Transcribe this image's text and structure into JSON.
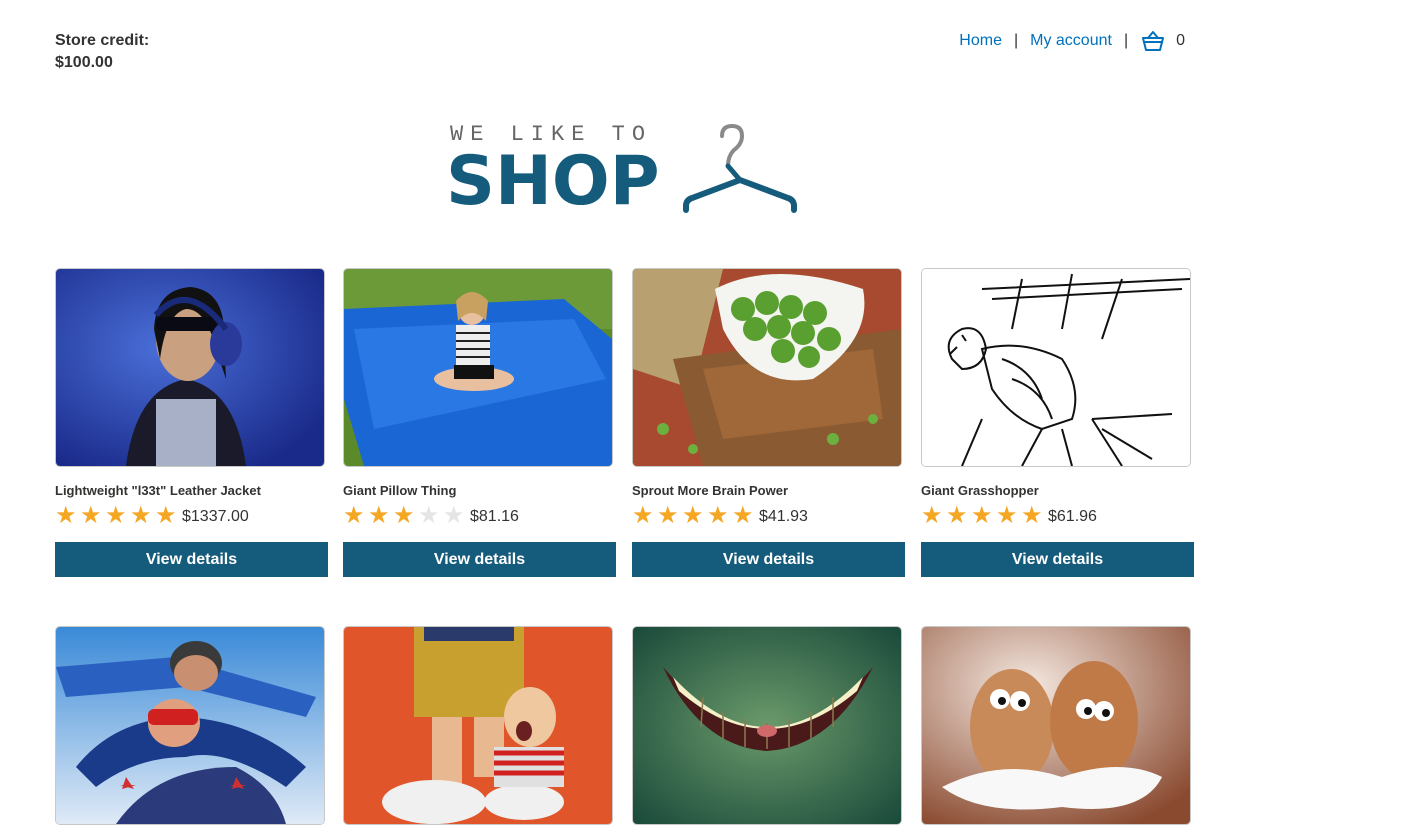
{
  "header": {
    "credit_label": "Store credit:",
    "credit_value": "$100.00",
    "nav_home": "Home",
    "nav_account": "My account",
    "separator": "|",
    "cart_icon": "cart-icon",
    "cart_count": "0"
  },
  "logo": {
    "tagline": "WE LIKE TO",
    "word": "SHOP",
    "icon": "hanger-icon"
  },
  "products": [
    {
      "name": "Lightweight \"l33t\" Leather Jacket",
      "rating": 5,
      "price": "$1337.00",
      "button": "View details"
    },
    {
      "name": "Giant Pillow Thing",
      "rating": 3,
      "price": "$81.16",
      "button": "View details"
    },
    {
      "name": "Sprout More Brain Power",
      "rating": 5,
      "price": "$41.93",
      "button": "View details"
    },
    {
      "name": "Giant Grasshopper",
      "rating": 5,
      "price": "$61.96",
      "button": "View details"
    },
    {
      "name": "",
      "rating": null,
      "price": "",
      "button": ""
    },
    {
      "name": "",
      "rating": null,
      "price": "",
      "button": ""
    },
    {
      "name": "",
      "rating": null,
      "price": "",
      "button": ""
    },
    {
      "name": "",
      "rating": null,
      "price": "",
      "button": ""
    }
  ],
  "colors": {
    "accent": "#155b7c",
    "link": "#0071bc",
    "star": "#f5a623"
  }
}
